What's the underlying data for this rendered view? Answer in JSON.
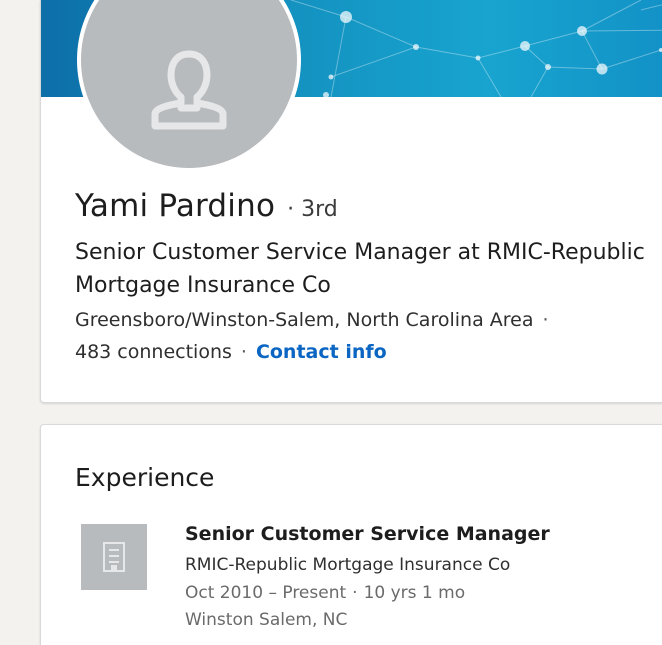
{
  "profile": {
    "name": "Yami Pardino",
    "degree_separator": "·",
    "degree": "3rd",
    "headline": "Senior Customer Service Manager at RMIC-Republic Mortgage Insurance Co",
    "location": "Greensboro/Winston-Salem, North Carolina Area",
    "location_separator": "·",
    "connections": "483 connections",
    "connections_separator": "·",
    "contact_info_label": "Contact info"
  },
  "experience": {
    "section_title": "Experience",
    "items": [
      {
        "title": "Senior Customer Service Manager",
        "company": "RMIC-Republic Mortgage Insurance Co",
        "date_range": "Oct 2010 – Present",
        "dot": "·",
        "duration": "10 yrs 1 mo",
        "location": "Winston Salem, NC"
      }
    ]
  },
  "colors": {
    "banner": "#138fbe",
    "link": "#0a66c2",
    "avatar_bg": "#b8bbbe"
  },
  "icons": {
    "avatar": "person-silhouette-icon",
    "company_logo": "building-icon"
  }
}
